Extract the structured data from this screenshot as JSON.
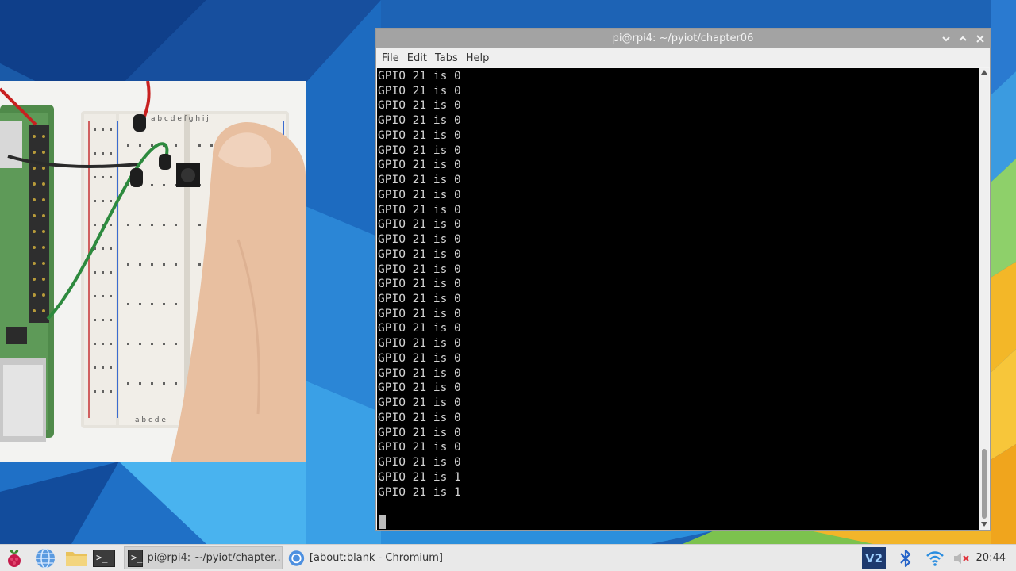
{
  "window": {
    "title": "pi@rpi4: ~/pyiot/chapter06",
    "menu": [
      "File",
      "Edit",
      "Tabs",
      "Help"
    ]
  },
  "terminal": {
    "lines": [
      "GPIO 21 is 0",
      "GPIO 21 is 0",
      "GPIO 21 is 0",
      "GPIO 21 is 0",
      "GPIO 21 is 0",
      "GPIO 21 is 0",
      "GPIO 21 is 0",
      "GPIO 21 is 0",
      "GPIO 21 is 0",
      "GPIO 21 is 0",
      "GPIO 21 is 0",
      "GPIO 21 is 0",
      "GPIO 21 is 0",
      "GPIO 21 is 0",
      "GPIO 21 is 0",
      "GPIO 21 is 0",
      "GPIO 21 is 0",
      "GPIO 21 is 0",
      "GPIO 21 is 0",
      "GPIO 21 is 0",
      "GPIO 21 is 0",
      "GPIO 21 is 0",
      "GPIO 21 is 0",
      "GPIO 21 is 0",
      "GPIO 21 is 0",
      "GPIO 21 is 0",
      "GPIO 21 is 0",
      "GPIO 21 is 1",
      "GPIO 21 is 1"
    ]
  },
  "photo": {
    "breadboard_top_letters": "a b c d e   f g h i j",
    "breadboard_bottom_letters": "a b c d e"
  },
  "taskbar": {
    "tasks": [
      {
        "label": "pi@rpi4: ~/pyiot/chapter...",
        "icon": "terminal-icon",
        "active": true
      },
      {
        "label": "[about:blank - Chromium]",
        "icon": "chromium-icon",
        "active": false
      }
    ],
    "tray_vnc_label": "V2",
    "clock": "20:44"
  },
  "colors": {
    "titlebar": "#a3a3a3",
    "terminal_bg": "#000000",
    "terminal_fg": "#d3d3d3",
    "taskbar": "#e9e9e9"
  }
}
